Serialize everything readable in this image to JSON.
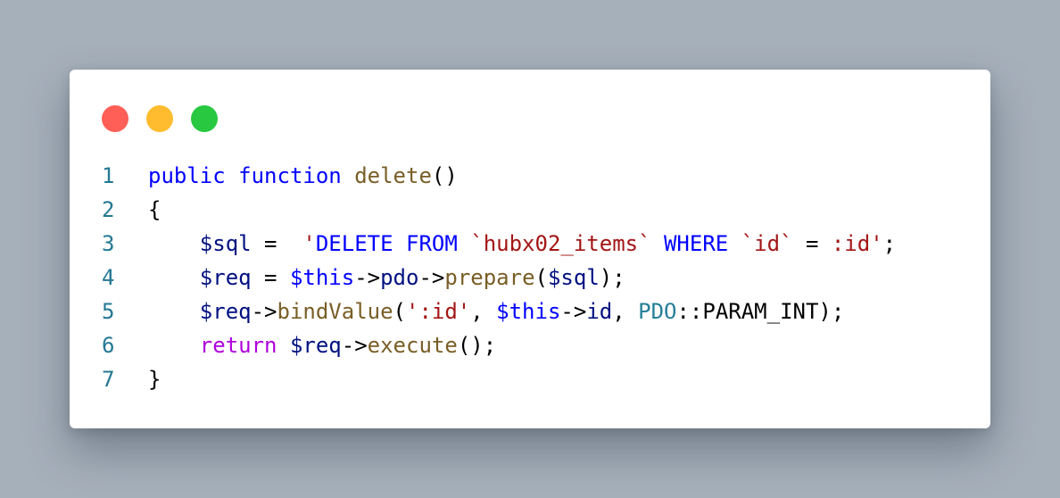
{
  "window": {
    "controls": {
      "close_color": "#ff5f57",
      "minimize_color": "#febc2e",
      "maximize_color": "#28c840"
    }
  },
  "code": {
    "language": "php",
    "lines": [
      {
        "number": "1",
        "tokens": [
          {
            "t": "public",
            "c": "kw"
          },
          {
            "t": " ",
            "c": "pl"
          },
          {
            "t": "function",
            "c": "kw"
          },
          {
            "t": " ",
            "c": "pl"
          },
          {
            "t": "delete",
            "c": "fn"
          },
          {
            "t": "()",
            "c": "pl"
          }
        ]
      },
      {
        "number": "2",
        "tokens": [
          {
            "t": "{",
            "c": "pl"
          }
        ]
      },
      {
        "number": "3",
        "tokens": [
          {
            "t": "    ",
            "c": "pl"
          },
          {
            "t": "$sql",
            "c": "var"
          },
          {
            "t": " =  ",
            "c": "pl"
          },
          {
            "t": "'",
            "c": "str"
          },
          {
            "t": "DELETE",
            "c": "sqlkw"
          },
          {
            "t": " ",
            "c": "str"
          },
          {
            "t": "FROM",
            "c": "sqlkw"
          },
          {
            "t": " `hubx02_items` ",
            "c": "str"
          },
          {
            "t": "WHERE",
            "c": "sqlkw"
          },
          {
            "t": " `id` ",
            "c": "str"
          },
          {
            "t": "=",
            "c": "pl"
          },
          {
            "t": " :id'",
            "c": "str"
          },
          {
            "t": ";",
            "c": "pl"
          }
        ]
      },
      {
        "number": "4",
        "tokens": [
          {
            "t": "    ",
            "c": "pl"
          },
          {
            "t": "$req",
            "c": "var"
          },
          {
            "t": " = ",
            "c": "pl"
          },
          {
            "t": "$this",
            "c": "this"
          },
          {
            "t": "->",
            "c": "pl"
          },
          {
            "t": "pdo",
            "c": "var"
          },
          {
            "t": "->",
            "c": "pl"
          },
          {
            "t": "prepare",
            "c": "fn"
          },
          {
            "t": "(",
            "c": "pl"
          },
          {
            "t": "$sql",
            "c": "var"
          },
          {
            "t": ");",
            "c": "pl"
          }
        ]
      },
      {
        "number": "5",
        "tokens": [
          {
            "t": "    ",
            "c": "pl"
          },
          {
            "t": "$req",
            "c": "var"
          },
          {
            "t": "->",
            "c": "pl"
          },
          {
            "t": "bindValue",
            "c": "fn"
          },
          {
            "t": "(",
            "c": "pl"
          },
          {
            "t": "':id'",
            "c": "str"
          },
          {
            "t": ", ",
            "c": "pl"
          },
          {
            "t": "$this",
            "c": "this"
          },
          {
            "t": "->",
            "c": "pl"
          },
          {
            "t": "id",
            "c": "var"
          },
          {
            "t": ", ",
            "c": "pl"
          },
          {
            "t": "PDO",
            "c": "cls"
          },
          {
            "t": "::PARAM_INT);",
            "c": "pl"
          }
        ]
      },
      {
        "number": "6",
        "tokens": [
          {
            "t": "    ",
            "c": "pl"
          },
          {
            "t": "return",
            "c": "ctl"
          },
          {
            "t": " ",
            "c": "pl"
          },
          {
            "t": "$req",
            "c": "var"
          },
          {
            "t": "->",
            "c": "pl"
          },
          {
            "t": "execute",
            "c": "fn"
          },
          {
            "t": "();",
            "c": "pl"
          }
        ]
      },
      {
        "number": "7",
        "tokens": [
          {
            "t": "}",
            "c": "pl"
          }
        ]
      }
    ]
  }
}
